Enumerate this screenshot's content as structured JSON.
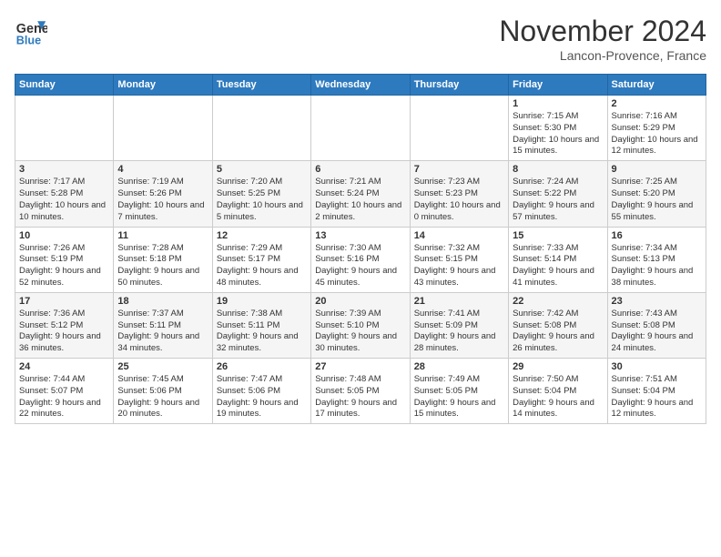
{
  "header": {
    "logo_line1": "General",
    "logo_line2": "Blue",
    "month": "November 2024",
    "location": "Lancon-Provence, France"
  },
  "days_of_week": [
    "Sunday",
    "Monday",
    "Tuesday",
    "Wednesday",
    "Thursday",
    "Friday",
    "Saturday"
  ],
  "weeks": [
    [
      {
        "day": "",
        "info": ""
      },
      {
        "day": "",
        "info": ""
      },
      {
        "day": "",
        "info": ""
      },
      {
        "day": "",
        "info": ""
      },
      {
        "day": "",
        "info": ""
      },
      {
        "day": "1",
        "info": "Sunrise: 7:15 AM\nSunset: 5:30 PM\nDaylight: 10 hours and 15 minutes."
      },
      {
        "day": "2",
        "info": "Sunrise: 7:16 AM\nSunset: 5:29 PM\nDaylight: 10 hours and 12 minutes."
      }
    ],
    [
      {
        "day": "3",
        "info": "Sunrise: 7:17 AM\nSunset: 5:28 PM\nDaylight: 10 hours and 10 minutes."
      },
      {
        "day": "4",
        "info": "Sunrise: 7:19 AM\nSunset: 5:26 PM\nDaylight: 10 hours and 7 minutes."
      },
      {
        "day": "5",
        "info": "Sunrise: 7:20 AM\nSunset: 5:25 PM\nDaylight: 10 hours and 5 minutes."
      },
      {
        "day": "6",
        "info": "Sunrise: 7:21 AM\nSunset: 5:24 PM\nDaylight: 10 hours and 2 minutes."
      },
      {
        "day": "7",
        "info": "Sunrise: 7:23 AM\nSunset: 5:23 PM\nDaylight: 10 hours and 0 minutes."
      },
      {
        "day": "8",
        "info": "Sunrise: 7:24 AM\nSunset: 5:22 PM\nDaylight: 9 hours and 57 minutes."
      },
      {
        "day": "9",
        "info": "Sunrise: 7:25 AM\nSunset: 5:20 PM\nDaylight: 9 hours and 55 minutes."
      }
    ],
    [
      {
        "day": "10",
        "info": "Sunrise: 7:26 AM\nSunset: 5:19 PM\nDaylight: 9 hours and 52 minutes."
      },
      {
        "day": "11",
        "info": "Sunrise: 7:28 AM\nSunset: 5:18 PM\nDaylight: 9 hours and 50 minutes."
      },
      {
        "day": "12",
        "info": "Sunrise: 7:29 AM\nSunset: 5:17 PM\nDaylight: 9 hours and 48 minutes."
      },
      {
        "day": "13",
        "info": "Sunrise: 7:30 AM\nSunset: 5:16 PM\nDaylight: 9 hours and 45 minutes."
      },
      {
        "day": "14",
        "info": "Sunrise: 7:32 AM\nSunset: 5:15 PM\nDaylight: 9 hours and 43 minutes."
      },
      {
        "day": "15",
        "info": "Sunrise: 7:33 AM\nSunset: 5:14 PM\nDaylight: 9 hours and 41 minutes."
      },
      {
        "day": "16",
        "info": "Sunrise: 7:34 AM\nSunset: 5:13 PM\nDaylight: 9 hours and 38 minutes."
      }
    ],
    [
      {
        "day": "17",
        "info": "Sunrise: 7:36 AM\nSunset: 5:12 PM\nDaylight: 9 hours and 36 minutes."
      },
      {
        "day": "18",
        "info": "Sunrise: 7:37 AM\nSunset: 5:11 PM\nDaylight: 9 hours and 34 minutes."
      },
      {
        "day": "19",
        "info": "Sunrise: 7:38 AM\nSunset: 5:11 PM\nDaylight: 9 hours and 32 minutes."
      },
      {
        "day": "20",
        "info": "Sunrise: 7:39 AM\nSunset: 5:10 PM\nDaylight: 9 hours and 30 minutes."
      },
      {
        "day": "21",
        "info": "Sunrise: 7:41 AM\nSunset: 5:09 PM\nDaylight: 9 hours and 28 minutes."
      },
      {
        "day": "22",
        "info": "Sunrise: 7:42 AM\nSunset: 5:08 PM\nDaylight: 9 hours and 26 minutes."
      },
      {
        "day": "23",
        "info": "Sunrise: 7:43 AM\nSunset: 5:08 PM\nDaylight: 9 hours and 24 minutes."
      }
    ],
    [
      {
        "day": "24",
        "info": "Sunrise: 7:44 AM\nSunset: 5:07 PM\nDaylight: 9 hours and 22 minutes."
      },
      {
        "day": "25",
        "info": "Sunrise: 7:45 AM\nSunset: 5:06 PM\nDaylight: 9 hours and 20 minutes."
      },
      {
        "day": "26",
        "info": "Sunrise: 7:47 AM\nSunset: 5:06 PM\nDaylight: 9 hours and 19 minutes."
      },
      {
        "day": "27",
        "info": "Sunrise: 7:48 AM\nSunset: 5:05 PM\nDaylight: 9 hours and 17 minutes."
      },
      {
        "day": "28",
        "info": "Sunrise: 7:49 AM\nSunset: 5:05 PM\nDaylight: 9 hours and 15 minutes."
      },
      {
        "day": "29",
        "info": "Sunrise: 7:50 AM\nSunset: 5:04 PM\nDaylight: 9 hours and 14 minutes."
      },
      {
        "day": "30",
        "info": "Sunrise: 7:51 AM\nSunset: 5:04 PM\nDaylight: 9 hours and 12 minutes."
      }
    ]
  ]
}
